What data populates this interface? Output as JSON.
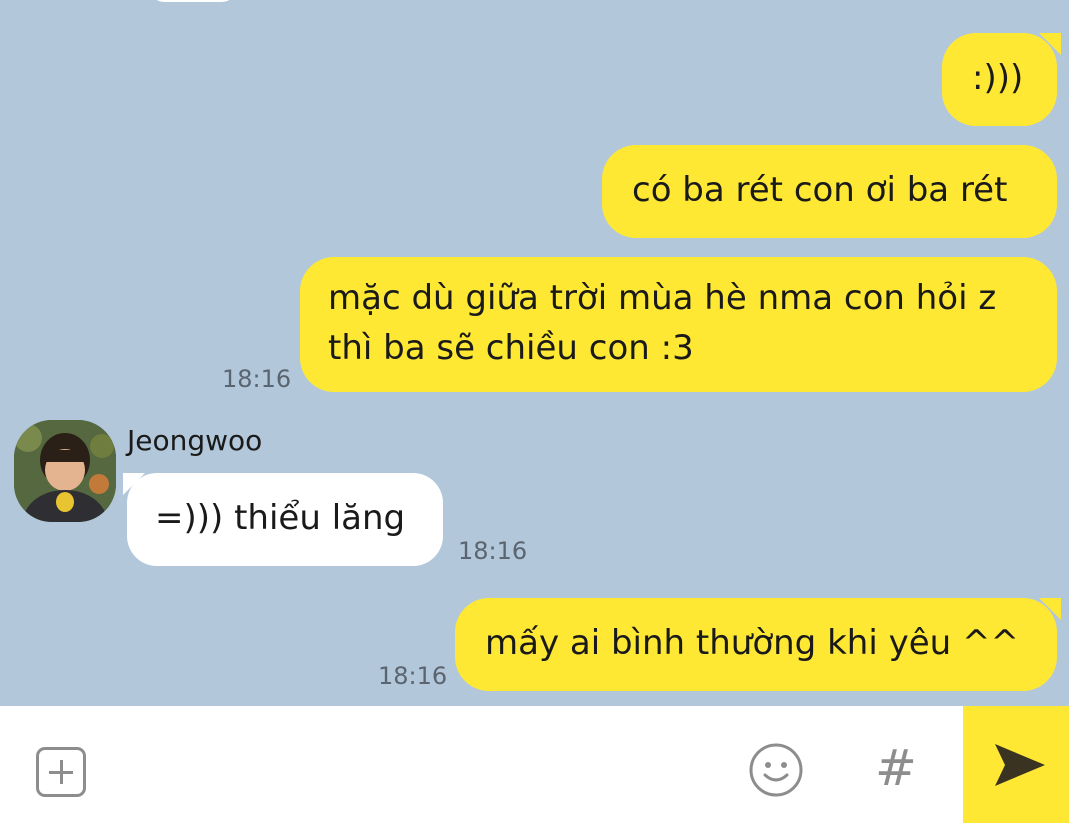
{
  "conversation": {
    "messages": [
      {
        "from": "me",
        "text": ":)))"
      },
      {
        "from": "me",
        "text": "có ba rét con ơi ba rét"
      },
      {
        "from": "me",
        "line1": "mặc dù giữa trời mùa hè nma con hỏi z",
        "line2": "thì ba sẽ chiều con :3",
        "time": "18:16"
      },
      {
        "from": "Jeongwoo",
        "sender": "Jeongwoo",
        "text": "=))) thiểu lăng",
        "time": "18:16"
      },
      {
        "from": "me",
        "text": "mấy ai bình thường khi yêu ^^",
        "time": "18:16"
      }
    ]
  },
  "input_bar": {
    "add_icon": "plus-square-icon",
    "emoji_icon": "smiley-icon",
    "hash_label": "#",
    "send_icon": "send-arrow-icon"
  },
  "colors": {
    "chat_background": "#b2c7da",
    "my_bubble": "#fee833",
    "their_bubble": "#ffffff",
    "send_button": "#fee833"
  }
}
